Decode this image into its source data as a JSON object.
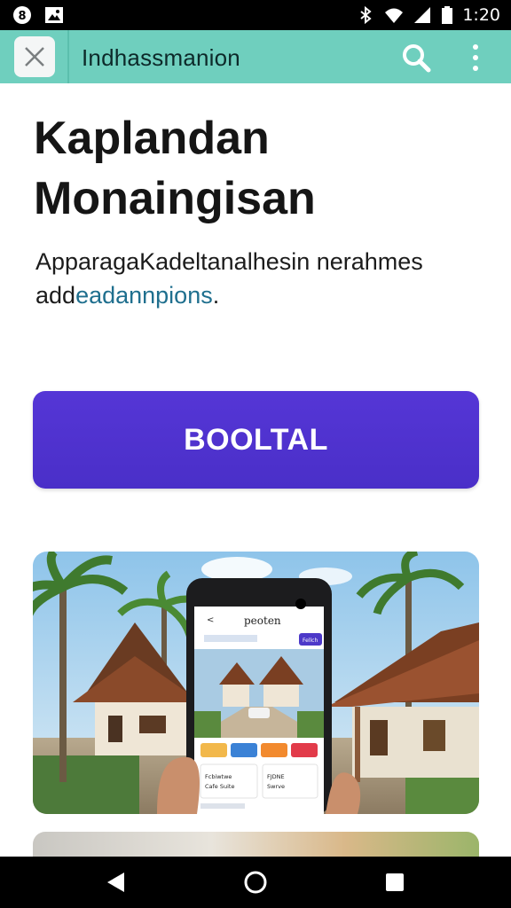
{
  "status_bar": {
    "time": "1:20",
    "left_icons": [
      "notification-icon",
      "image-icon"
    ],
    "right_icons": [
      "bluetooth-icon",
      "wifi-icon",
      "cellular-signal-icon",
      "battery-icon"
    ]
  },
  "app_bar": {
    "title": "Indhassmanion",
    "close_icon": "close-icon",
    "search_icon": "search-icon",
    "more_icon": "more-vert-icon",
    "background_color": "#6fcfbe"
  },
  "content": {
    "headline_line1": "Kaplandan",
    "headline_line2": "Monaingisan",
    "subtext_part1": "ApparagaKadeltanalhesin nerahmes add",
    "subtext_accent": "eadannpions",
    "subtext_end": ".",
    "cta_label": "BOOLTAL",
    "cta_color": "#5033d0"
  },
  "hero": {
    "phone_screen_title": "peoten",
    "phone_tag_label": "Fellch",
    "phone_chip_colors": [
      "#f2b84b",
      "#3b82d6",
      "#f28a2e",
      "#e23b4a"
    ],
    "phone_card1_line1": "Fcbiwtwe",
    "phone_card1_line2": "Cafe Suite",
    "phone_card2_line1": "FJDNE",
    "phone_card2_line2": "Swrve"
  },
  "nav_bar": {
    "icons": [
      "back-icon",
      "home-icon",
      "recents-icon"
    ]
  }
}
